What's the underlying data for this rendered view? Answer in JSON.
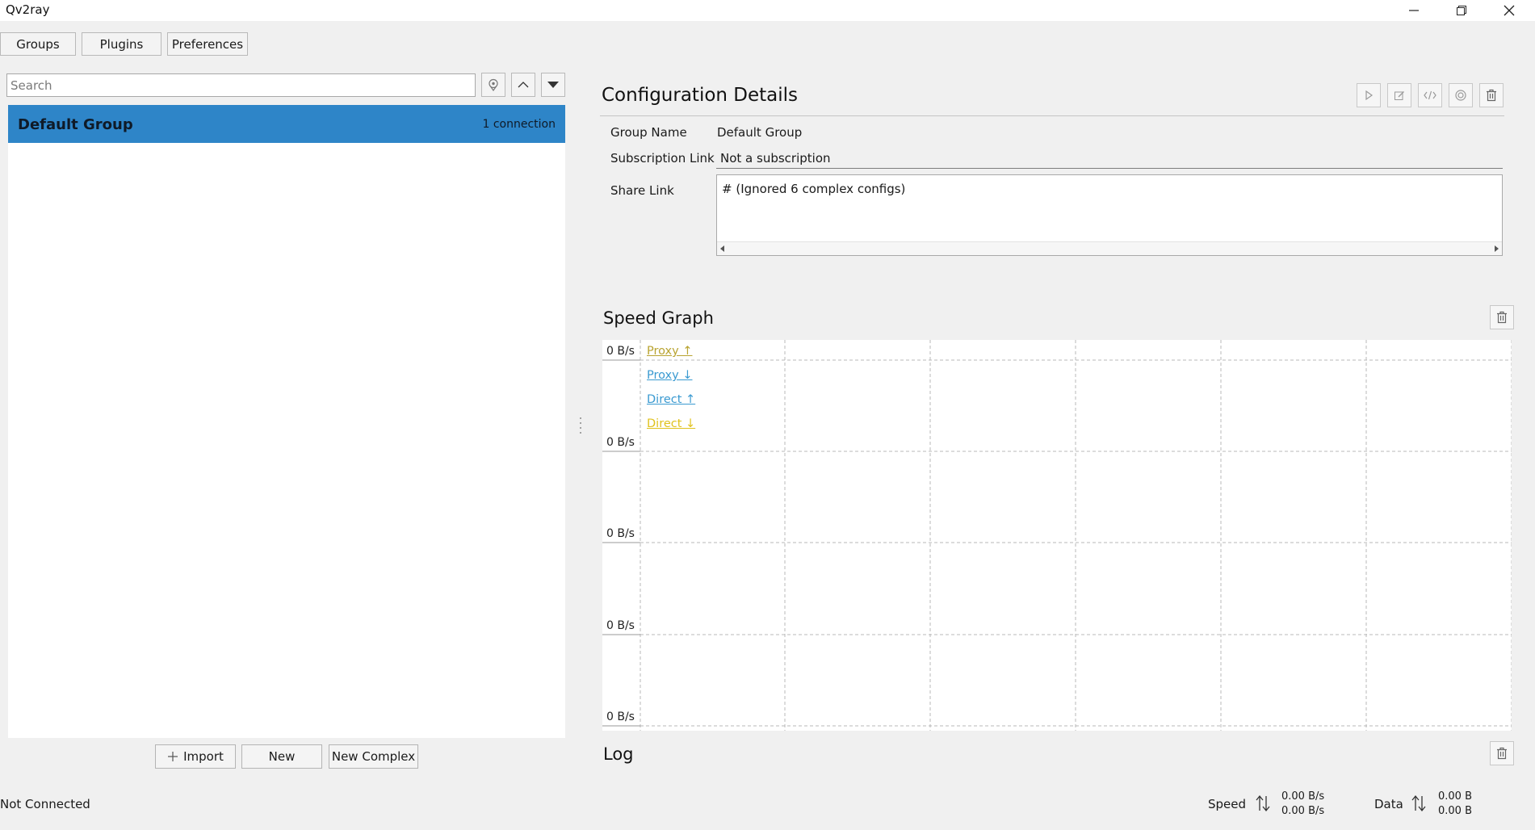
{
  "window": {
    "title": "Qv2ray"
  },
  "toolbar": {
    "groups": "Groups",
    "plugins": "Plugins",
    "preferences": "Preferences"
  },
  "search": {
    "placeholder": "Search",
    "value": ""
  },
  "groups": [
    {
      "name": "Default Group",
      "count": "1 connection"
    }
  ],
  "bottom_buttons": {
    "import": "Import",
    "new": "New",
    "new_complex": "New Complex"
  },
  "status": {
    "connection": "Not Connected"
  },
  "config": {
    "title": "Configuration Details",
    "group_name_label": "Group Name",
    "group_name_value": "Default Group",
    "subscription_label": "Subscription Link",
    "subscription_value": "Not a subscription",
    "share_label": "Share Link",
    "share_value": "# (Ignored 6 complex configs)"
  },
  "speed_graph": {
    "title": "Speed Graph",
    "y_labels": [
      "0 B/s",
      "0 B/s",
      "0 B/s",
      "0 B/s",
      "0 B/s"
    ],
    "legend": [
      {
        "label": "Proxy ↑",
        "color": "#b9a432"
      },
      {
        "label": "Proxy ↓",
        "color": "#3a9ad1"
      },
      {
        "label": "Direct ↑",
        "color": "#3a9ad1"
      },
      {
        "label": "Direct ↓",
        "color": "#e0c21e"
      }
    ]
  },
  "log": {
    "title": "Log"
  },
  "stats": {
    "speed_label": "Speed",
    "speed_up": "0.00 B/s",
    "speed_down": "0.00 B/s",
    "data_label": "Data",
    "data_up": "0.00 B",
    "data_down": "0.00 B"
  },
  "colors": {
    "selection": "#2e85c8",
    "accent": "#1f5f9a"
  }
}
